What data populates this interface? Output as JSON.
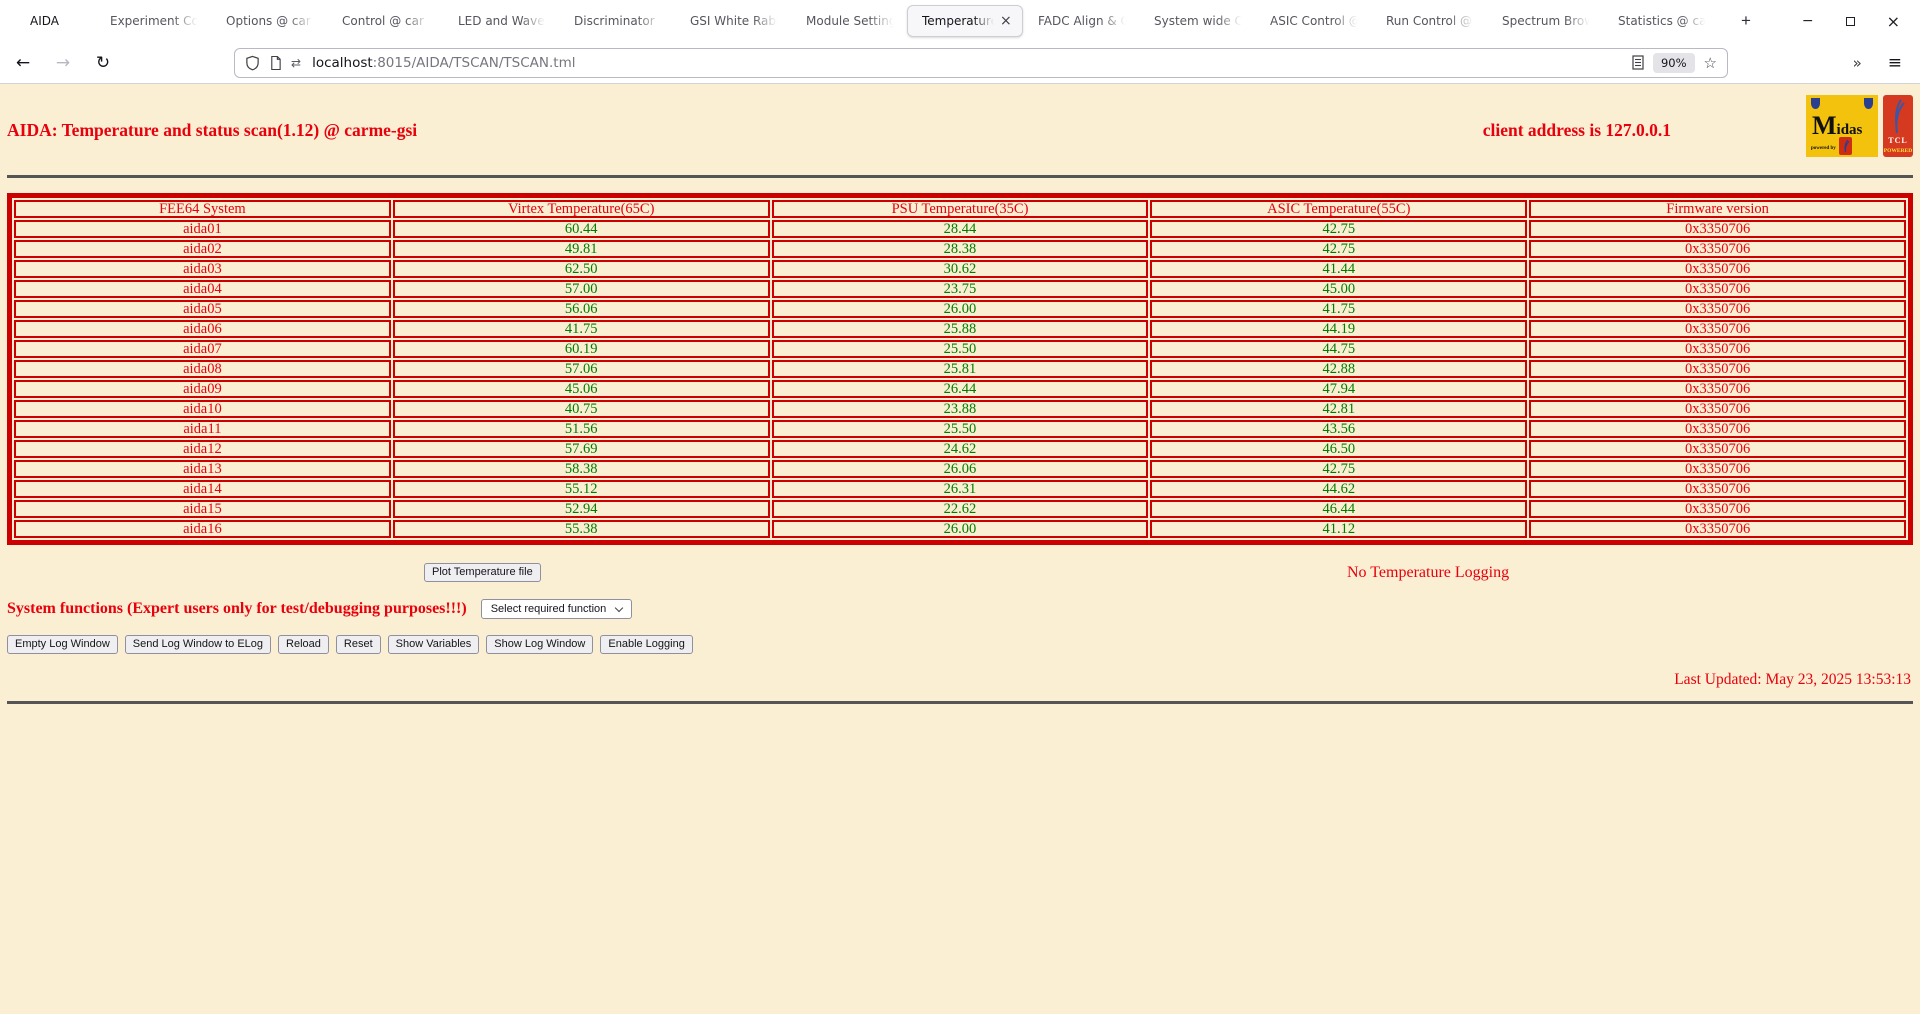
{
  "browser": {
    "tabs": [
      {
        "label": "AIDA",
        "active": false,
        "closable": false,
        "first": true
      },
      {
        "label": "Experiment Co",
        "active": false,
        "closable": false
      },
      {
        "label": "Options @ car",
        "active": false,
        "closable": false
      },
      {
        "label": "Control @ car",
        "active": false,
        "closable": false
      },
      {
        "label": "LED and Wavef",
        "active": false,
        "closable": false
      },
      {
        "label": "Discriminator",
        "active": false,
        "closable": false
      },
      {
        "label": "GSI White Rabb",
        "active": false,
        "closable": false
      },
      {
        "label": "Module Setting",
        "active": false,
        "closable": false
      },
      {
        "label": "Temperature",
        "active": true,
        "closable": true
      },
      {
        "label": "FADC Align & C",
        "active": false,
        "closable": false
      },
      {
        "label": "System wide C",
        "active": false,
        "closable": false
      },
      {
        "label": "ASIC Control @",
        "active": false,
        "closable": false
      },
      {
        "label": "Run Control @",
        "active": false,
        "closable": false
      },
      {
        "label": "Spectrum Brow",
        "active": false,
        "closable": false
      },
      {
        "label": "Statistics @ ca",
        "active": false,
        "closable": false
      }
    ],
    "icons": {
      "new_tab": "+",
      "minimize": "−",
      "close": "×",
      "tab_close": "×",
      "back": "←",
      "forward": "→",
      "reload": "↻",
      "permissions": "⇄",
      "star": "☆",
      "overflow": "»",
      "menu": "≡"
    },
    "url": {
      "host": "localhost",
      "rest": ":8015/AIDA/TSCAN/TSCAN.tml"
    },
    "zoom_badge": "90%"
  },
  "page": {
    "title": "AIDA: Temperature and status scan(1.12) @ carme-gsi",
    "client_address": "client address is 127.0.0.1",
    "logos": {
      "midas": "Midas",
      "powered_by": "powered by",
      "tcl": "TCL",
      "tcl_powered": "POWERED"
    },
    "table": {
      "headers": [
        "FEE64 System",
        "Virtex Temperature(65C)",
        "PSU Temperature(35C)",
        "ASIC Temperature(55C)",
        "Firmware version"
      ],
      "rows": [
        [
          "aida01",
          "60.44",
          "28.44",
          "42.75",
          "0x3350706"
        ],
        [
          "aida02",
          "49.81",
          "28.38",
          "42.75",
          "0x3350706"
        ],
        [
          "aida03",
          "62.50",
          "30.62",
          "41.44",
          "0x3350706"
        ],
        [
          "aida04",
          "57.00",
          "23.75",
          "45.00",
          "0x3350706"
        ],
        [
          "aida05",
          "56.06",
          "26.00",
          "41.75",
          "0x3350706"
        ],
        [
          "aida06",
          "41.75",
          "25.88",
          "44.19",
          "0x3350706"
        ],
        [
          "aida07",
          "60.19",
          "25.50",
          "44.75",
          "0x3350706"
        ],
        [
          "aida08",
          "57.06",
          "25.81",
          "42.88",
          "0x3350706"
        ],
        [
          "aida09",
          "45.06",
          "26.44",
          "47.94",
          "0x3350706"
        ],
        [
          "aida10",
          "40.75",
          "23.88",
          "42.81",
          "0x3350706"
        ],
        [
          "aida11",
          "51.56",
          "25.50",
          "43.56",
          "0x3350706"
        ],
        [
          "aida12",
          "57.69",
          "24.62",
          "46.50",
          "0x3350706"
        ],
        [
          "aida13",
          "58.38",
          "26.06",
          "42.75",
          "0x3350706"
        ],
        [
          "aida14",
          "55.12",
          "26.31",
          "44.62",
          "0x3350706"
        ],
        [
          "aida15",
          "52.94",
          "22.62",
          "46.44",
          "0x3350706"
        ],
        [
          "aida16",
          "55.38",
          "26.00",
          "41.12",
          "0x3350706"
        ]
      ]
    },
    "plot_button": "Plot Temperature file",
    "logging_status": "No Temperature Logging",
    "system_functions_label": "System functions (Expert users only for test/debugging purposes!!!)",
    "function_select_value": "Select required function",
    "action_buttons": [
      "Empty Log Window",
      "Send Log Window to ELog",
      "Reload",
      "Reset",
      "Show Variables",
      "Show Log Window",
      "Enable Logging"
    ],
    "last_updated": "Last Updated: May 23, 2025 13:53:13"
  },
  "colors": {
    "page_bg": "#fbefd3",
    "text_red": "#e8000d",
    "value_green": "#007d00",
    "table_border": "#cc0000"
  }
}
